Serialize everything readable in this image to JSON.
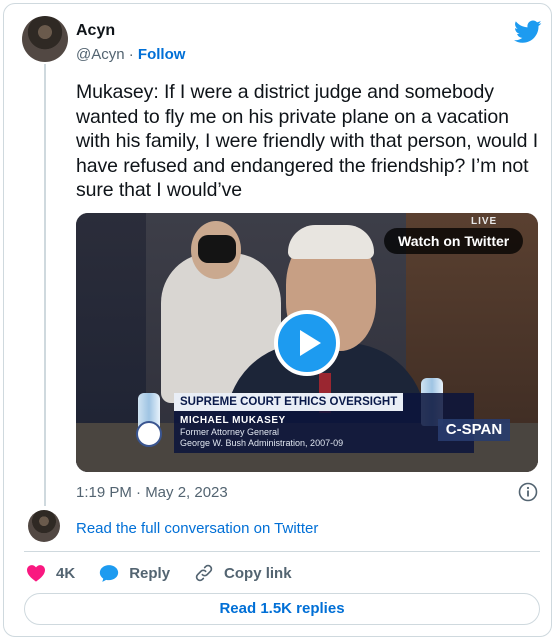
{
  "author": {
    "name": "Acyn",
    "handle": "@Acyn",
    "separator": "·",
    "follow_label": "Follow"
  },
  "tweet": {
    "text": "Mukasey: If I were a district judge and somebody wanted to fly me on his private plane on a vacation with his family, I were friendly with that person, would I have refused and endangered the friendship? I’m not sure that I would’ve",
    "timestamp": "1:19 PM · May 2, 2023"
  },
  "video": {
    "watch_label": "Watch on Twitter",
    "live_label": "LIVE",
    "chyron_title": "SUPREME COURT ETHICS OVERSIGHT",
    "chyron_name": "MICHAEL MUKASEY",
    "chyron_line1": "Former Attorney General",
    "chyron_line2": "George W. Bush Administration, 2007-09",
    "network": "C-SPAN"
  },
  "conversation": {
    "read_label": "Read the full conversation on Twitter"
  },
  "actions": {
    "likes_count": "4K",
    "reply_label": "Reply",
    "copy_link_label": "Copy link"
  },
  "replies": {
    "button_label": "Read 1.5K replies"
  },
  "icons": {
    "brand": "twitter-bird-icon",
    "like": "heart-icon",
    "reply": "reply-bubble-icon",
    "copy": "link-icon",
    "info": "info-icon",
    "play": "play-icon"
  },
  "colors": {
    "brand_blue": "#1d9bf0",
    "link_blue": "#006fd6",
    "like_pink": "#f91880",
    "muted_text": "#536471",
    "border": "#cfd9de"
  }
}
